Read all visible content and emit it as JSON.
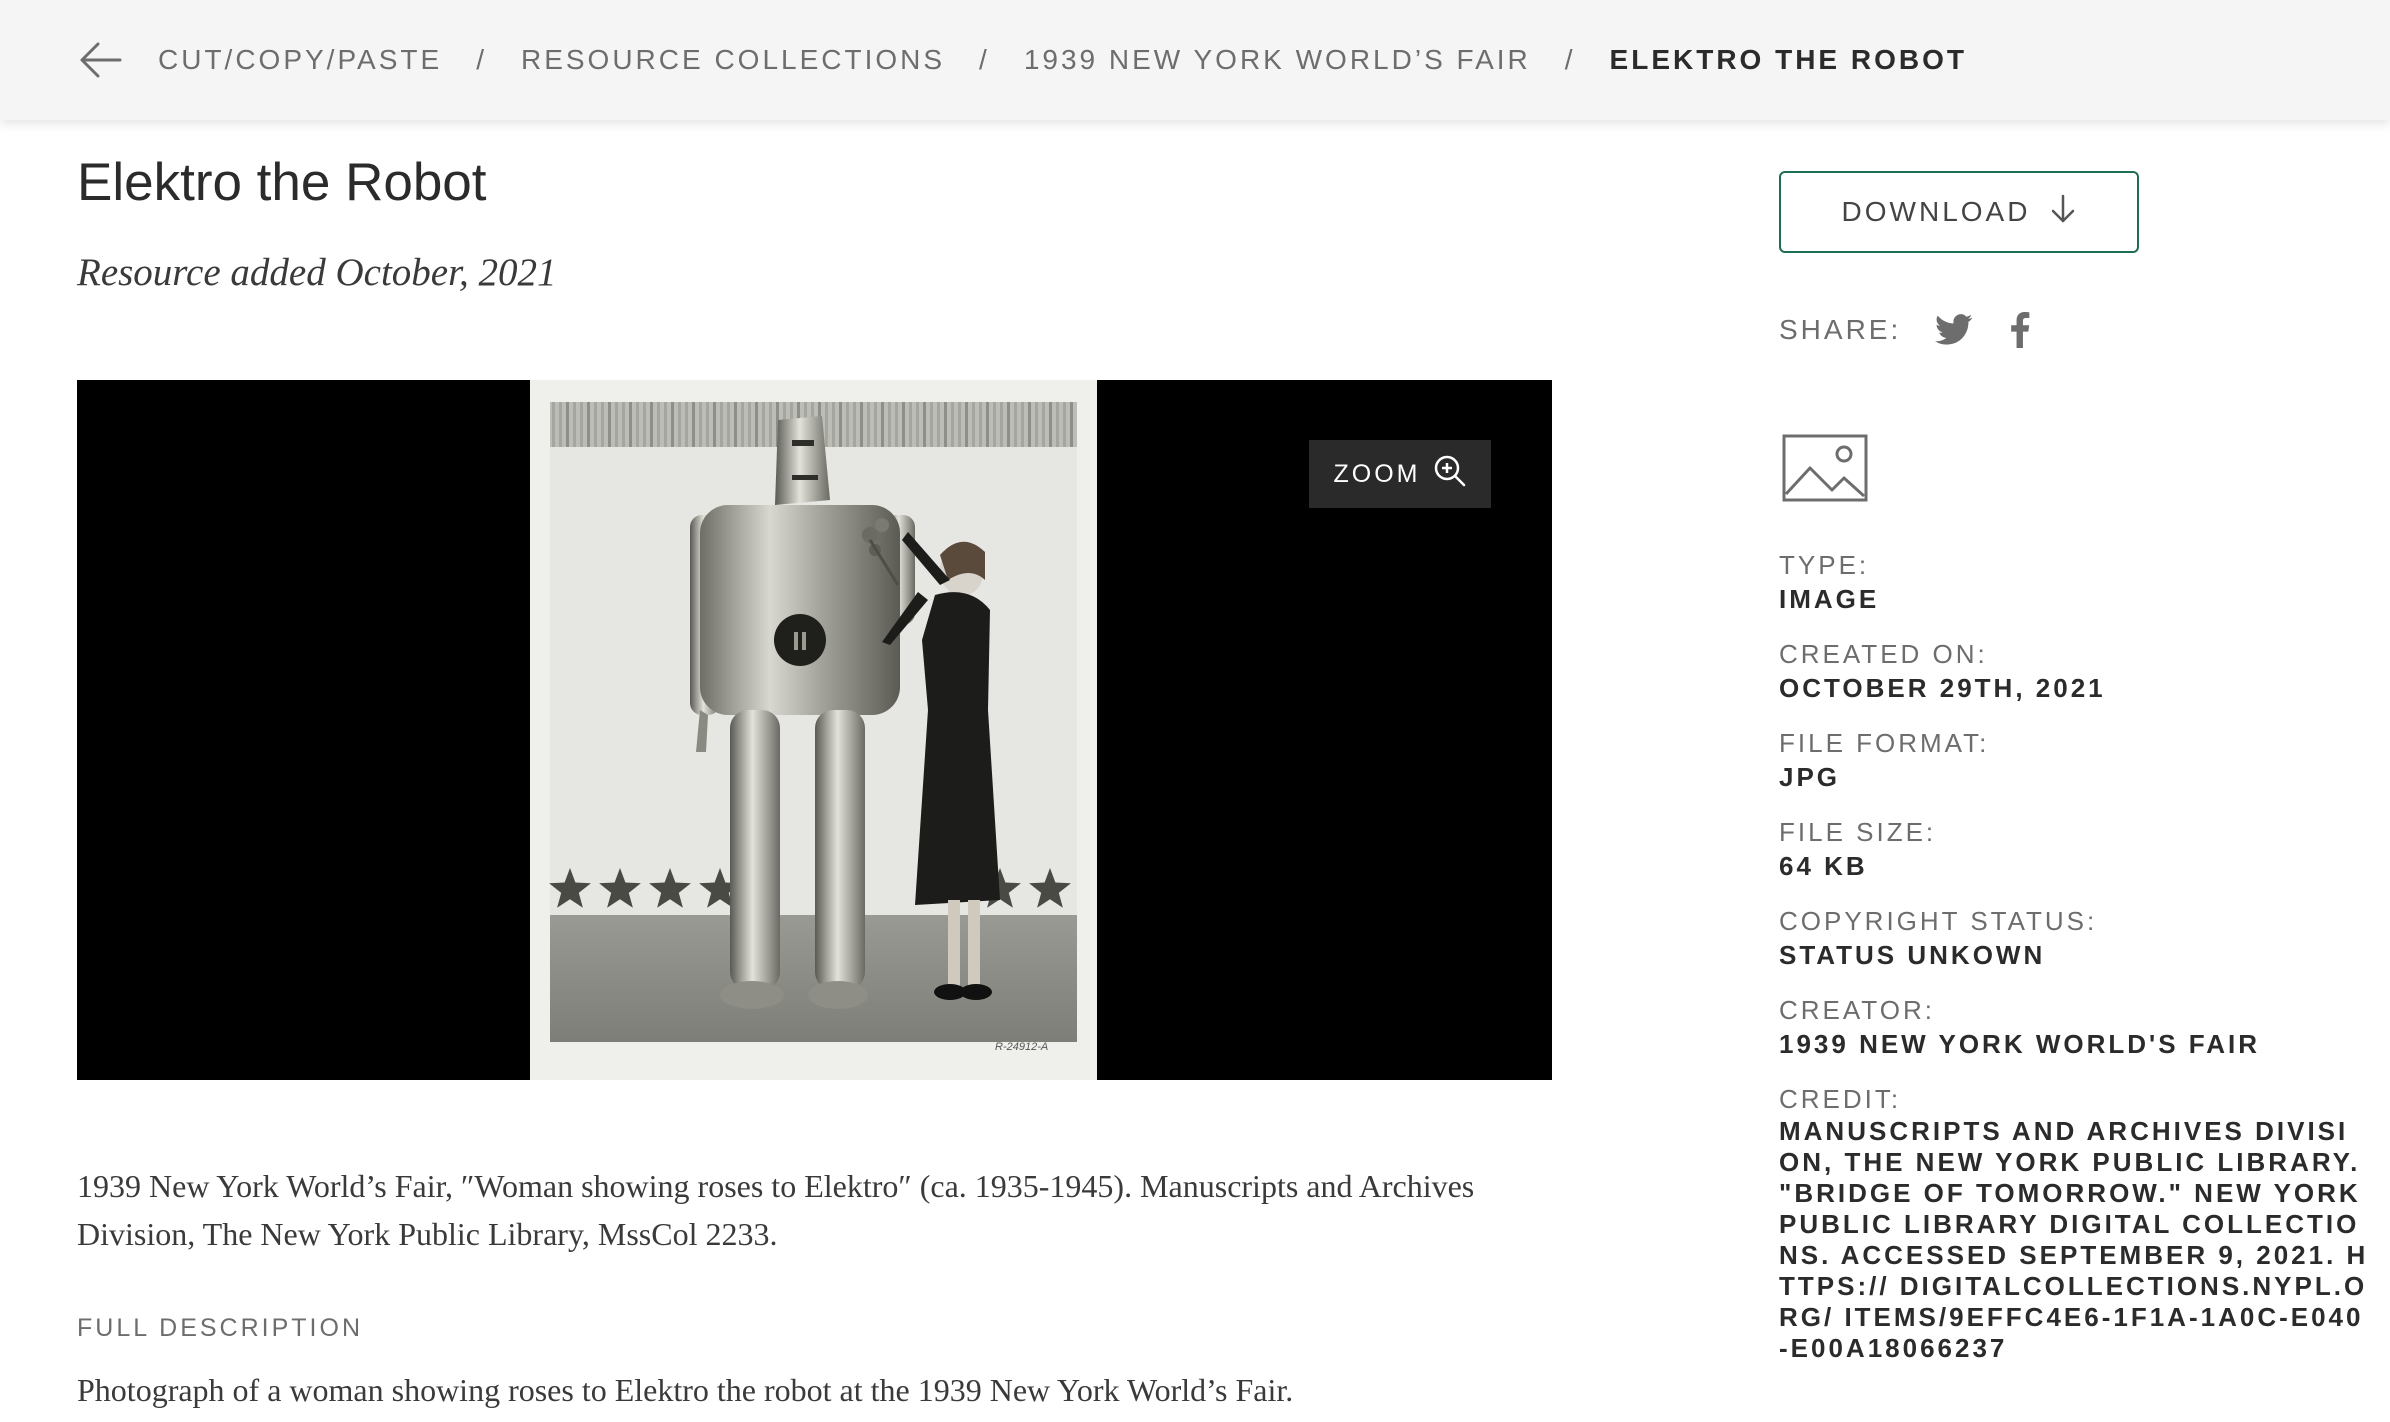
{
  "breadcrumb": {
    "items": [
      {
        "label": "CUT/COPY/PASTE"
      },
      {
        "label": "RESOURCE COLLECTIONS"
      },
      {
        "label": "1939 NEW YORK WORLD’S FAIR"
      },
      {
        "label": "ELEKTRO THE ROBOT"
      }
    ],
    "separator": "/",
    "back_icon": "arrow-left-icon"
  },
  "resource": {
    "title": "Elektro the Robot",
    "added": "Resource added October, 2021",
    "image": {
      "alt": "Woman showing roses to Elektro the robot",
      "zoom_label": "ZOOM",
      "zoom_icon": "zoom-in-icon",
      "film_label": "R-24912-A"
    },
    "caption": "1939 New York World’s Fair, ″Woman showing roses to Elektro″ (ca. 1935-1945). Manuscripts and Archives Division, The New York Public Library, MssCol 2233.",
    "full_description_label": "FULL DESCRIPTION",
    "full_description": "Photograph of a woman showing roses to Elektro the robot at the 1939 New York World’s Fair."
  },
  "sidebar": {
    "download_label": "DOWNLOAD",
    "download_icon": "arrow-down-icon",
    "share_label": "SHARE:",
    "share_icons": [
      "twitter-icon",
      "facebook-icon"
    ],
    "type_icon": "image-icon",
    "meta": [
      {
        "label": "TYPE:",
        "value": "IMAGE"
      },
      {
        "label": "CREATED ON:",
        "value": "OCTOBER 29TH, 2021"
      },
      {
        "label": "FILE FORMAT:",
        "value": "JPG"
      },
      {
        "label": "FILE SIZE:",
        "value": "64 KB"
      },
      {
        "label": "COPYRIGHT STATUS:",
        "value": "STATUS UNKOWN"
      },
      {
        "label": "CREATOR:",
        "value": "1939 NEW YORK WORLD'S FAIR"
      },
      {
        "label": "CREDIT:",
        "value": "MANUSCRIPTS AND ARCHIVES DIVISION, THE NEW YORK PUBLIC LIBRARY. \"BRIDGE OF TOMORROW.\" NEW YORK PUBLIC LIBRARY DIGITAL COLLECTIONS. ACCESSED SEPTEMBER 9, 2021. HTTPS:// DIGITALCOLLECTIONS.NYPL.ORG/ ITEMS/9EFFC4E6-1F1A-1A0C-E040-E00A18066237"
      }
    ]
  },
  "colors": {
    "accent_border": "#1e6e52",
    "header_bg": "#f5f5f5",
    "muted_text": "#6d6d6d",
    "dark_text": "#2b2b2b"
  }
}
